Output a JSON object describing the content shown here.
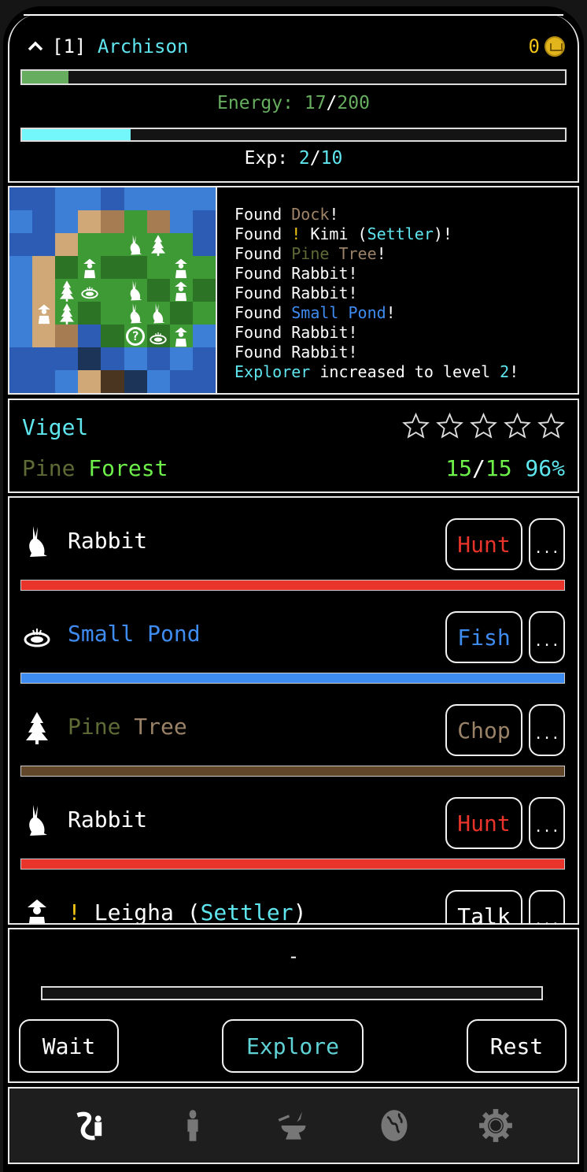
{
  "header": {
    "collapse_icon": "chevron-up-icon",
    "level": "[1]",
    "name": "Archison",
    "coins": "0",
    "coin_icon": "crown-coin-icon",
    "energy": {
      "label": "Energy:",
      "current": "17",
      "max": "200",
      "fraction": 0.085
    },
    "exp": {
      "label": "Exp:",
      "current": "2",
      "max": "10",
      "fraction": 0.2
    }
  },
  "log": [
    [
      {
        "t": "Found "
      },
      {
        "t": "Dock",
        "c": "#a08468"
      },
      {
        "t": "!"
      }
    ],
    [
      {
        "t": "Found "
      },
      {
        "t": "!",
        "c": "#f2c416"
      },
      {
        "t": " Kimi ("
      },
      {
        "t": "Settler",
        "c": "#5fe6ef"
      },
      {
        "t": ")!"
      }
    ],
    [
      {
        "t": "Found "
      },
      {
        "t": "Pine",
        "c": "#5e6b36"
      },
      {
        "t": " "
      },
      {
        "t": "Tree",
        "c": "#9a8268"
      },
      {
        "t": "!"
      }
    ],
    [
      {
        "t": "Found Rabbit!"
      }
    ],
    [
      {
        "t": "Found Rabbit!"
      }
    ],
    [
      {
        "t": "Found "
      },
      {
        "t": "Small Pond",
        "c": "#3f8cf0"
      },
      {
        "t": "!"
      }
    ],
    [
      {
        "t": "Found Rabbit!"
      }
    ],
    [
      {
        "t": "Found Rabbit!"
      }
    ],
    [
      {
        "t": "Explorer",
        "c": "#5fe6ef"
      },
      {
        "t": " increased to level "
      },
      {
        "t": "2",
        "c": "#5fe6ef"
      },
      {
        "t": "!"
      }
    ]
  ],
  "location": {
    "region": "Vigel",
    "biome_word1": "Pine",
    "biome_word2": "Forest",
    "count_current": "15",
    "count_max": "15",
    "percent": "96%",
    "rating_stars": 0,
    "rating_max": 5
  },
  "list": [
    {
      "icon": "rabbit-icon",
      "name": [
        {
          "t": "Rabbit",
          "c": "#ffffff"
        }
      ],
      "action": "Hunt",
      "action_color": "#e8342a",
      "bar_color": "#e8342a",
      "more": "..."
    },
    {
      "icon": "pond-icon",
      "name": [
        {
          "t": "Small Pond",
          "c": "#3f8cf0"
        }
      ],
      "action": "Fish",
      "action_color": "#3f8cf0",
      "bar_color": "#3f8cf0",
      "more": "..."
    },
    {
      "icon": "pine-tree-icon",
      "name": [
        {
          "t": "Pine",
          "c": "#5e6b36"
        },
        {
          "t": " "
        },
        {
          "t": "Tree",
          "c": "#9a8268"
        }
      ],
      "action": "Chop",
      "action_color": "#9a8268",
      "bar_color": "#61462a",
      "more": "..."
    },
    {
      "icon": "rabbit-icon",
      "name": [
        {
          "t": "Rabbit",
          "c": "#ffffff"
        }
      ],
      "action": "Hunt",
      "action_color": "#e8342a",
      "bar_color": "#e8342a",
      "more": "..."
    },
    {
      "icon": "settler-icon",
      "name": [
        {
          "t": "!",
          "c": "#f2c416"
        },
        {
          "t": " Leigha (",
          "c": "#ffffff"
        },
        {
          "t": "Settler",
          "c": "#5fe6ef"
        },
        {
          "t": ")",
          "c": "#ffffff"
        }
      ],
      "action": "Talk",
      "action_color": "#ffffff",
      "bar_color": "#ffffff",
      "more": "..."
    }
  ],
  "actions": {
    "status": "-",
    "progress": 0,
    "wait": "Wait",
    "explore": "Explore",
    "rest": "Rest"
  },
  "nav": [
    {
      "icon": "explore-icon",
      "active": true
    },
    {
      "icon": "character-icon",
      "active": false
    },
    {
      "icon": "crafting-anvil-icon",
      "active": false
    },
    {
      "icon": "world-globe-icon",
      "active": false
    },
    {
      "icon": "settings-gear-icon",
      "active": false
    }
  ]
}
